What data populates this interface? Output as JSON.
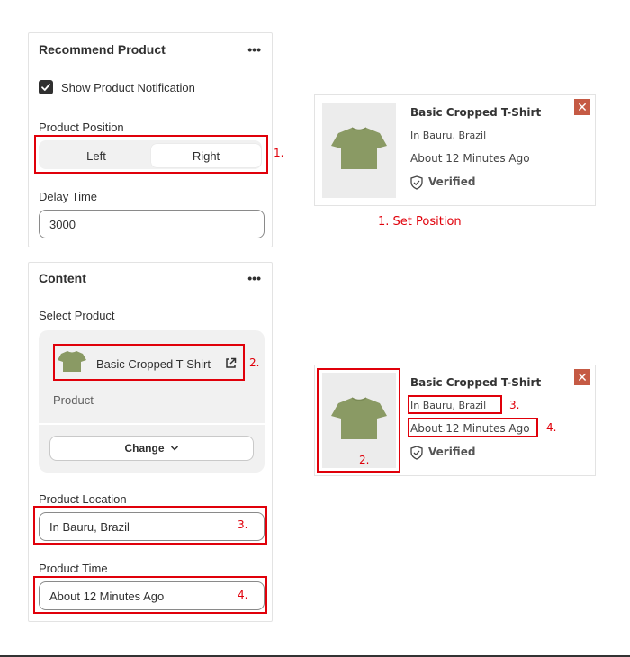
{
  "panel1": {
    "title": "Recommend Product",
    "more": "•••",
    "show_notification_label": "Show Product Notification",
    "show_notification_checked": true,
    "position_label": "Product Position",
    "position_options": [
      "Left",
      "Right"
    ],
    "position_selected": "Right",
    "delay_label": "Delay Time",
    "delay_value": "3000"
  },
  "panel2": {
    "title": "Content",
    "more": "•••",
    "select_product_label": "Select Product",
    "product_name": "Basic Cropped T-Shirt",
    "product_type": "Product",
    "change_label": "Change",
    "location_label": "Product Location",
    "location_value": "In Bauru, Brazil",
    "time_label": "Product Time",
    "time_value": "About 12 Minutes Ago"
  },
  "card": {
    "title": "Basic Cropped T-Shirt",
    "location": "In Bauru, Brazil",
    "time": "About 12 Minutes Ago",
    "verified": "Verified",
    "close": "✕"
  },
  "annotations": {
    "n1": "1.",
    "n2": "2.",
    "n3": "3.",
    "n4": "4.",
    "caption": "1. Set Position"
  },
  "colors": {
    "annotation_red": "#e0000a",
    "shirt_green": "#8a9a64",
    "close_bg": "#c55a44"
  },
  "icons": {
    "checkbox": "checkmark-icon",
    "external": "external-link-icon",
    "chevron": "chevron-down-icon",
    "verified": "shield-check-icon",
    "close": "close-icon",
    "shirt": "tshirt-image"
  }
}
